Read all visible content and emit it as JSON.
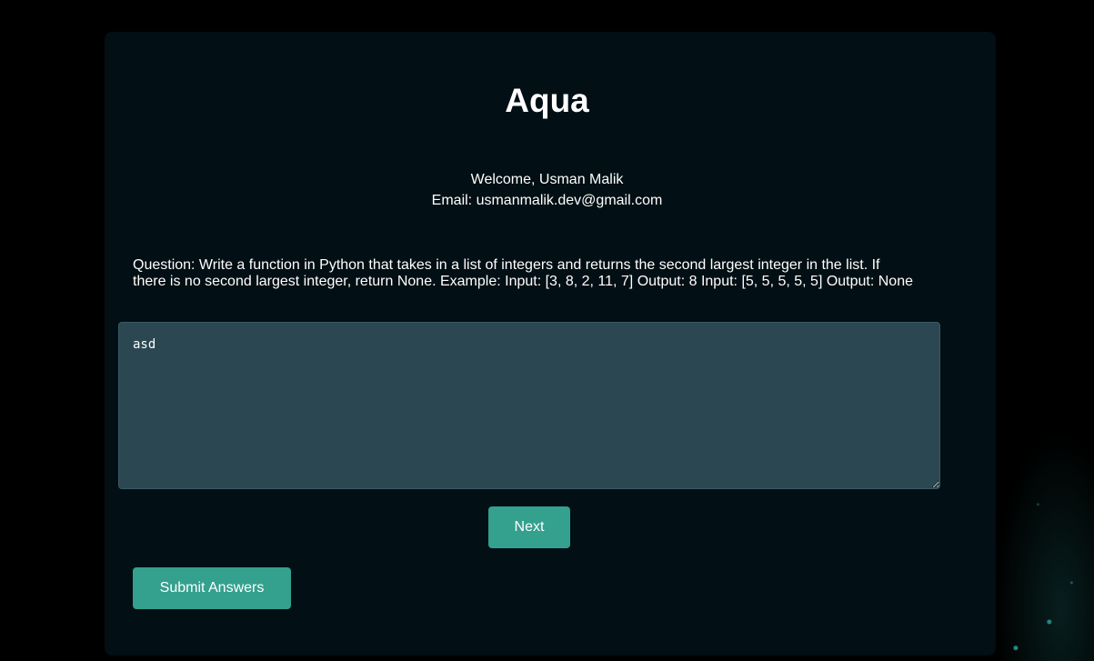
{
  "app": {
    "title": "Aqua"
  },
  "user": {
    "welcome": "Welcome, Usman Malik",
    "email": "Email: usmanmalik.dev@gmail.com"
  },
  "quiz": {
    "question": "Question: Write a function in Python that takes in a list of integers and returns the second largest integer in the list. If there is no second largest integer, return None. Example: Input: [3, 8, 2, 11, 7] Output: 8 Input: [5, 5, 5, 5, 5] Output: None",
    "answer_value": "asd",
    "next_label": "Next",
    "submit_label": "Submit Answers"
  },
  "colors": {
    "page_background": "#000000",
    "card_background": "#020f14",
    "textarea_background": "#2b4852",
    "button_accent": "#34a08e"
  }
}
